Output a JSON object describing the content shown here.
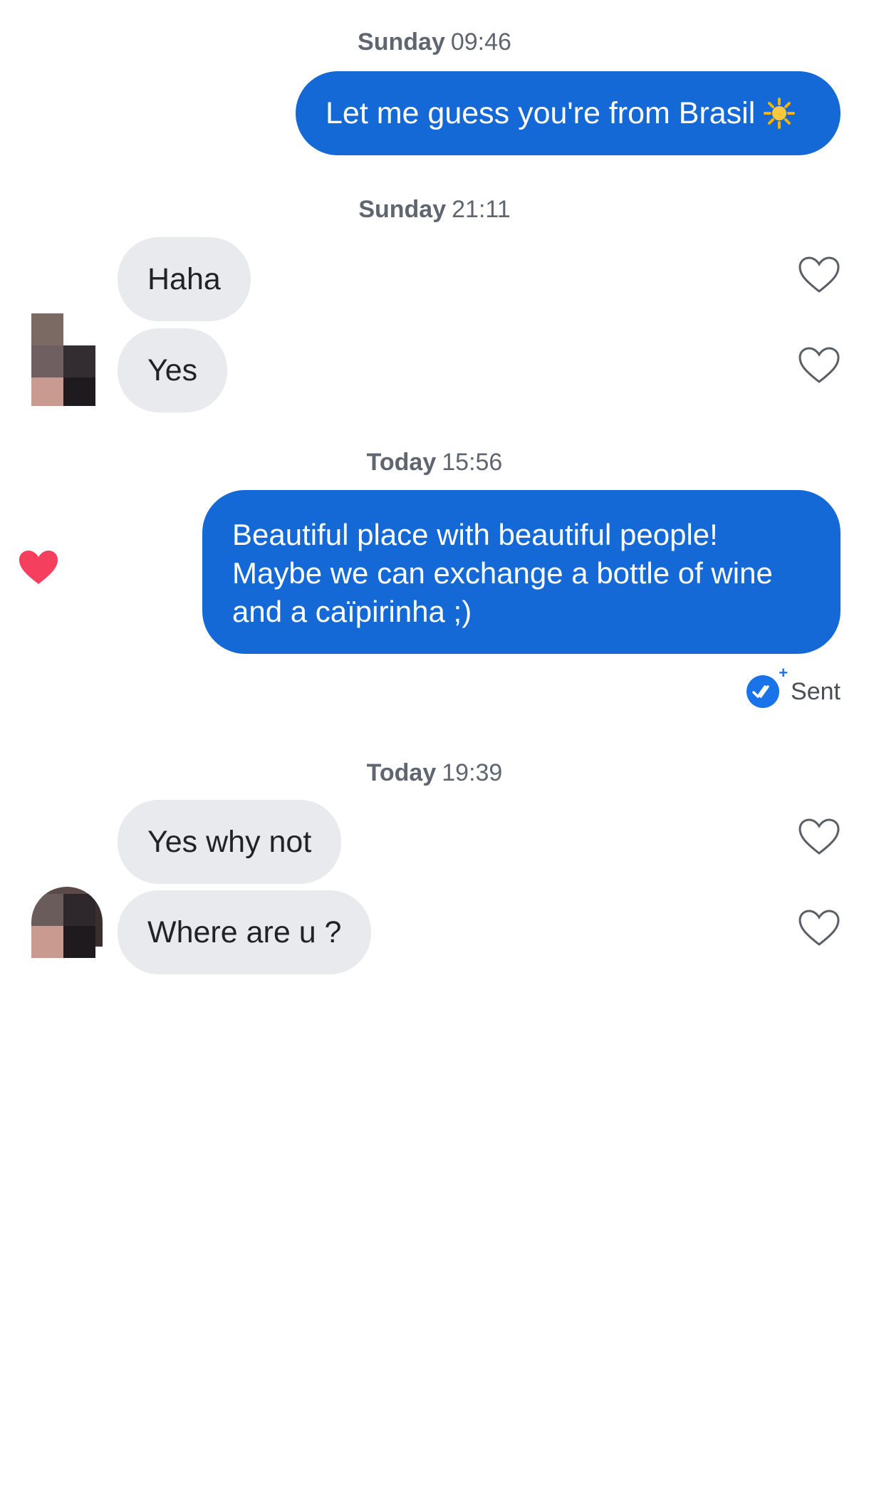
{
  "colors": {
    "sent_bubble": "#1469d6",
    "received_bubble": "#e9eaee",
    "liked_heart": "#f43f5e",
    "timestamp": "#5f6670"
  },
  "groups": [
    {
      "day": "Sunday",
      "time": "09:46"
    },
    {
      "day": "Sunday",
      "time": "21:11"
    },
    {
      "day": "Today",
      "time": "15:56"
    },
    {
      "day": "Today",
      "time": "19:39"
    }
  ],
  "messages": {
    "m1": {
      "text": "Let me guess you're from Brasil",
      "emoji_icon": "sun-emoji-icon"
    },
    "m2": {
      "text": "Haha"
    },
    "m3": {
      "text": "Yes"
    },
    "m4": {
      "line1": "Beautiful place with beautiful people!",
      "line2": "Maybe we can exchange a bottle of wine",
      "line3": "and a caïpirinha ;)",
      "liked": true
    },
    "m5": {
      "text": "Yes why not"
    },
    "m6": {
      "text": "Where are u ?"
    }
  },
  "status": {
    "label": "Sent",
    "icon": "double-check-icon"
  },
  "icons": {
    "like": "heart-outline-icon",
    "liked": "heart-filled-icon"
  }
}
